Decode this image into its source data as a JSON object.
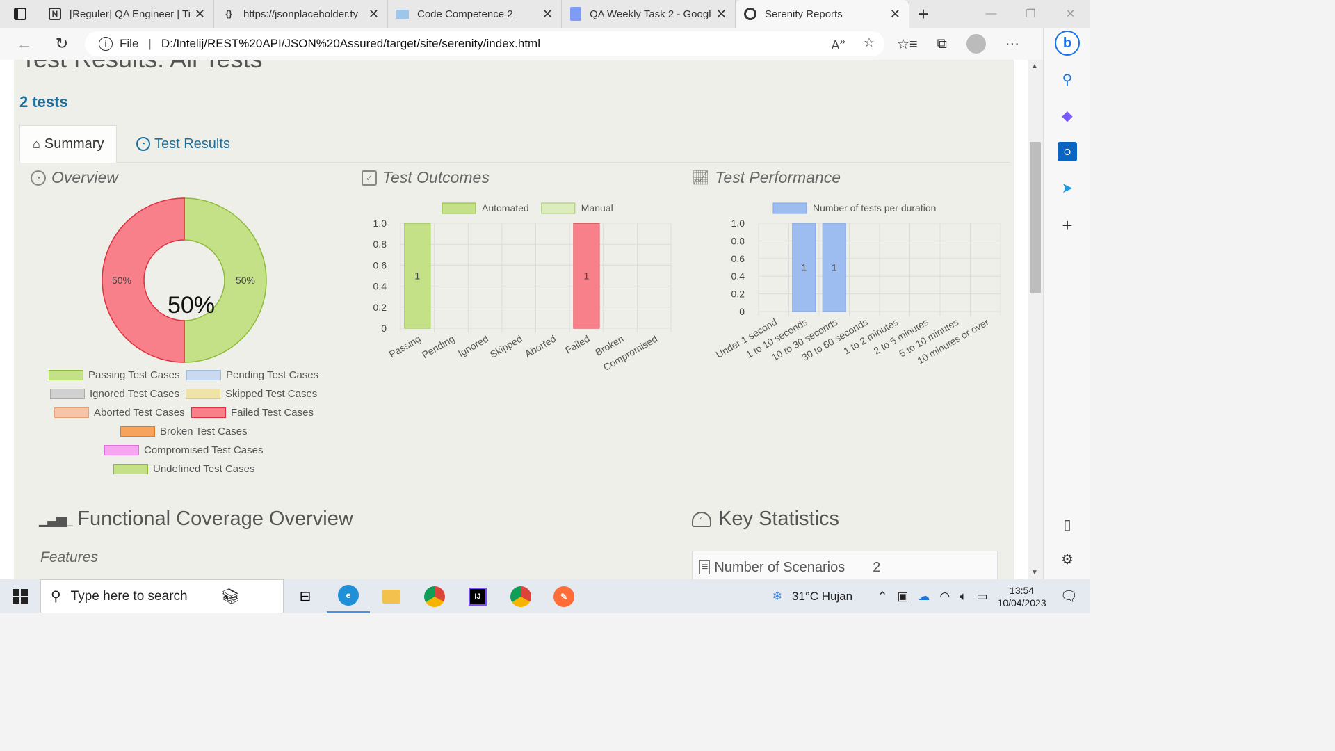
{
  "browser": {
    "tabs": [
      {
        "icon": "notion-icon",
        "title": "[Reguler] QA Engineer | Ti"
      },
      {
        "icon": "json-icon",
        "title": "https://jsonplaceholder.ty"
      },
      {
        "icon": "laptop-icon",
        "title": "Code Competence 2"
      },
      {
        "icon": "docs-icon",
        "title": "QA Weekly Task 2 - Googl"
      },
      {
        "icon": "serenity-icon",
        "title": "Serenity Reports",
        "active": true
      }
    ],
    "address": {
      "scheme": "File",
      "url": "D:/Intelij/REST%20API/JSON%20Assured/target/site/serenity/index.html"
    }
  },
  "report": {
    "title": "Test Results: All Tests",
    "tests_count": "2 tests",
    "tabs": {
      "summary": "Summary",
      "results": "Test Results"
    },
    "overview": {
      "heading": "Overview",
      "center_label": "50%",
      "slice_labels": {
        "passing": "50%",
        "failing": "50%"
      },
      "legend": [
        {
          "label": "Passing Test Cases",
          "color": "#c5e188",
          "border": "#8dbb3a"
        },
        {
          "label": "Pending Test Cases",
          "color": "#c9daf0",
          "border": "#a7bedb"
        },
        {
          "label": "Ignored Test Cases",
          "color": "#d0d0d0",
          "border": "#aaaaaa"
        },
        {
          "label": "Skipped Test Cases",
          "color": "#efe3a8",
          "border": "#d9cc86"
        },
        {
          "label": "Aborted Test Cases",
          "color": "#f6c4a6",
          "border": "#e6a07a"
        },
        {
          "label": "Failed Test Cases",
          "color": "#f7808a",
          "border": "#e0303e"
        },
        {
          "label": "Broken Test Cases",
          "color": "#f7a35c",
          "border": "#e07b26"
        },
        {
          "label": "Compromised Test Cases",
          "color": "#f6a6f0",
          "border": "#e070db"
        },
        {
          "label": "Undefined Test Cases",
          "color": "#c5e188",
          "border": "#8dbb3a"
        }
      ]
    },
    "outcomes": {
      "heading": "Test Outcomes",
      "legend": [
        {
          "label": "Automated",
          "color": "#c5e188",
          "border": "#8dbb3a"
        },
        {
          "label": "Manual",
          "color": "#dcecbd",
          "border": "#a5c870"
        }
      ]
    },
    "performance": {
      "heading": "Test Performance",
      "legend": [
        {
          "label": "Number of tests per duration",
          "color": "#9dbcf0",
          "border": "#7fa5e6"
        }
      ]
    },
    "functional_coverage": "Functional Coverage Overview",
    "features": "Features",
    "key_statistics": "Key Statistics",
    "stat_label": "Number of Scenarios",
    "stat_value": "2"
  },
  "chart_data": [
    {
      "type": "pie",
      "title": "",
      "categories": [
        "Passing",
        "Failed"
      ],
      "values": [
        50,
        50
      ],
      "colors": [
        "#c5e188",
        "#f7808a"
      ]
    },
    {
      "type": "bar",
      "title": "",
      "categories": [
        "Passing",
        "Pending",
        "Ignored",
        "Skipped",
        "Aborted",
        "Failed",
        "Broken",
        "Compromised"
      ],
      "values": [
        1,
        0,
        0,
        0,
        0,
        1,
        0,
        0
      ],
      "bar_colors": [
        "#c5e188",
        "#c5e188",
        "#c5e188",
        "#c5e188",
        "#c5e188",
        "#f7808a",
        "#c5e188",
        "#c5e188"
      ],
      "data_labels": [
        "1",
        "",
        "",
        "",
        "",
        "1",
        "",
        ""
      ],
      "yticks": [
        "0",
        "0.2",
        "0.4",
        "0.6",
        "0.8",
        "1.0"
      ],
      "ylim": [
        0,
        1.0
      ]
    },
    {
      "type": "bar",
      "title": "",
      "categories": [
        "Under 1 second",
        "1 to 10 seconds",
        "10 to 30 seconds",
        "30 to 60 seconds",
        "1 to 2 minutes",
        "2 to 5 minutes",
        "5 to 10 minutes",
        "10 minutes or over"
      ],
      "series": [
        {
          "name": "Number of tests per duration",
          "values": [
            0,
            1,
            1,
            0,
            0,
            0,
            0,
            0
          ]
        }
      ],
      "data_labels": [
        "",
        "1",
        "1",
        "",
        "",
        "",
        "",
        ""
      ],
      "yticks": [
        "0",
        "0.2",
        "0.4",
        "0.6",
        "0.8",
        "1.0"
      ],
      "ylim": [
        0,
        1.0
      ]
    }
  ],
  "sidebar_icons": [
    "search-icon",
    "copilot-icon",
    "outlook-icon",
    "send-icon",
    "add-icon",
    "split-icon",
    "settings-icon"
  ],
  "taskbar": {
    "search_placeholder": "Type here to search",
    "weather": "31°C  Hujan",
    "time": "13:54",
    "date": "10/04/2023"
  }
}
